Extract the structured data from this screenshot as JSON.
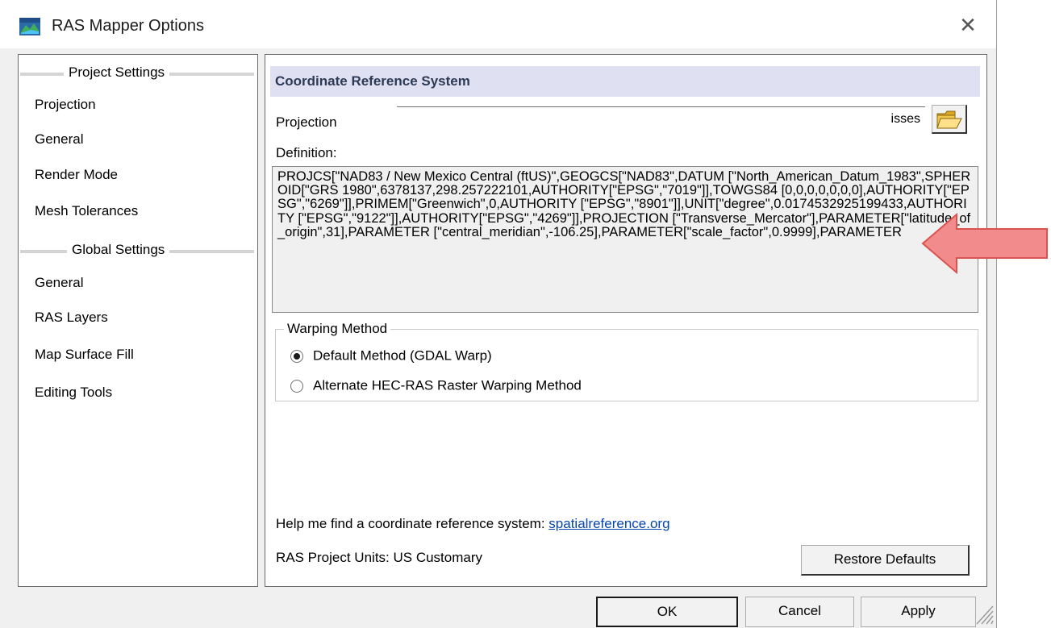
{
  "window": {
    "title": "RAS Mapper Options",
    "icon": "ras-mapper-app-icon",
    "close_glyph": "✕"
  },
  "left_nav": {
    "project_group": "Project Settings",
    "project_items": [
      "Projection",
      "General",
      "Render Mode",
      "Mesh Tolerances"
    ],
    "global_group": "Global Settings",
    "global_items": [
      "General",
      "RAS Layers",
      "Map Surface Fill",
      "Editing Tools"
    ]
  },
  "main": {
    "section_title": "Coordinate Reference System",
    "projection_label": "Projection",
    "projection_value": "isses",
    "definition_label": "Definition:",
    "definition_text": "PROJCS[\"NAD83 / New Mexico Central (ftUS)\",GEOGCS[\"NAD83\",DATUM [\"North_American_Datum_1983\",SPHEROID[\"GRS 1980\",6378137,298.257222101,AUTHORITY[\"EPSG\",\"7019\"]],TOWGS84 [0,0,0,0,0,0,0],AUTHORITY[\"EPSG\",\"6269\"]],PRIMEM[\"Greenwich\",0,AUTHORITY [\"EPSG\",\"8901\"]],UNIT[\"degree\",0.0174532925199433,AUTHORITY [\"EPSG\",\"9122\"]],AUTHORITY[\"EPSG\",\"4269\"]],PROJECTION [\"Transverse_Mercator\"],PARAMETER[\"latitude_of_origin\",31],PARAMETER [\"central_meridian\",-106.25],PARAMETER[\"scale_factor\",0.9999],PARAMETER",
    "warping": {
      "title": "Warping Method",
      "options": [
        "Default Method (GDAL Warp)",
        "Alternate HEC-RAS Raster Warping Method"
      ],
      "selected_index": 0
    },
    "help_prefix": "Help me find a coordinate reference system: ",
    "help_link": "spatialreference.org",
    "units_text": "RAS Project Units: US Customary",
    "restore_label": "Restore Defaults"
  },
  "footer": {
    "ok_label": "OK",
    "cancel_label": "Cancel",
    "apply_label": "Apply"
  },
  "colors": {
    "section_header_bg": "#e0e0f3",
    "annotation_arrow": "#f28b8b",
    "link": "#0645ad"
  }
}
